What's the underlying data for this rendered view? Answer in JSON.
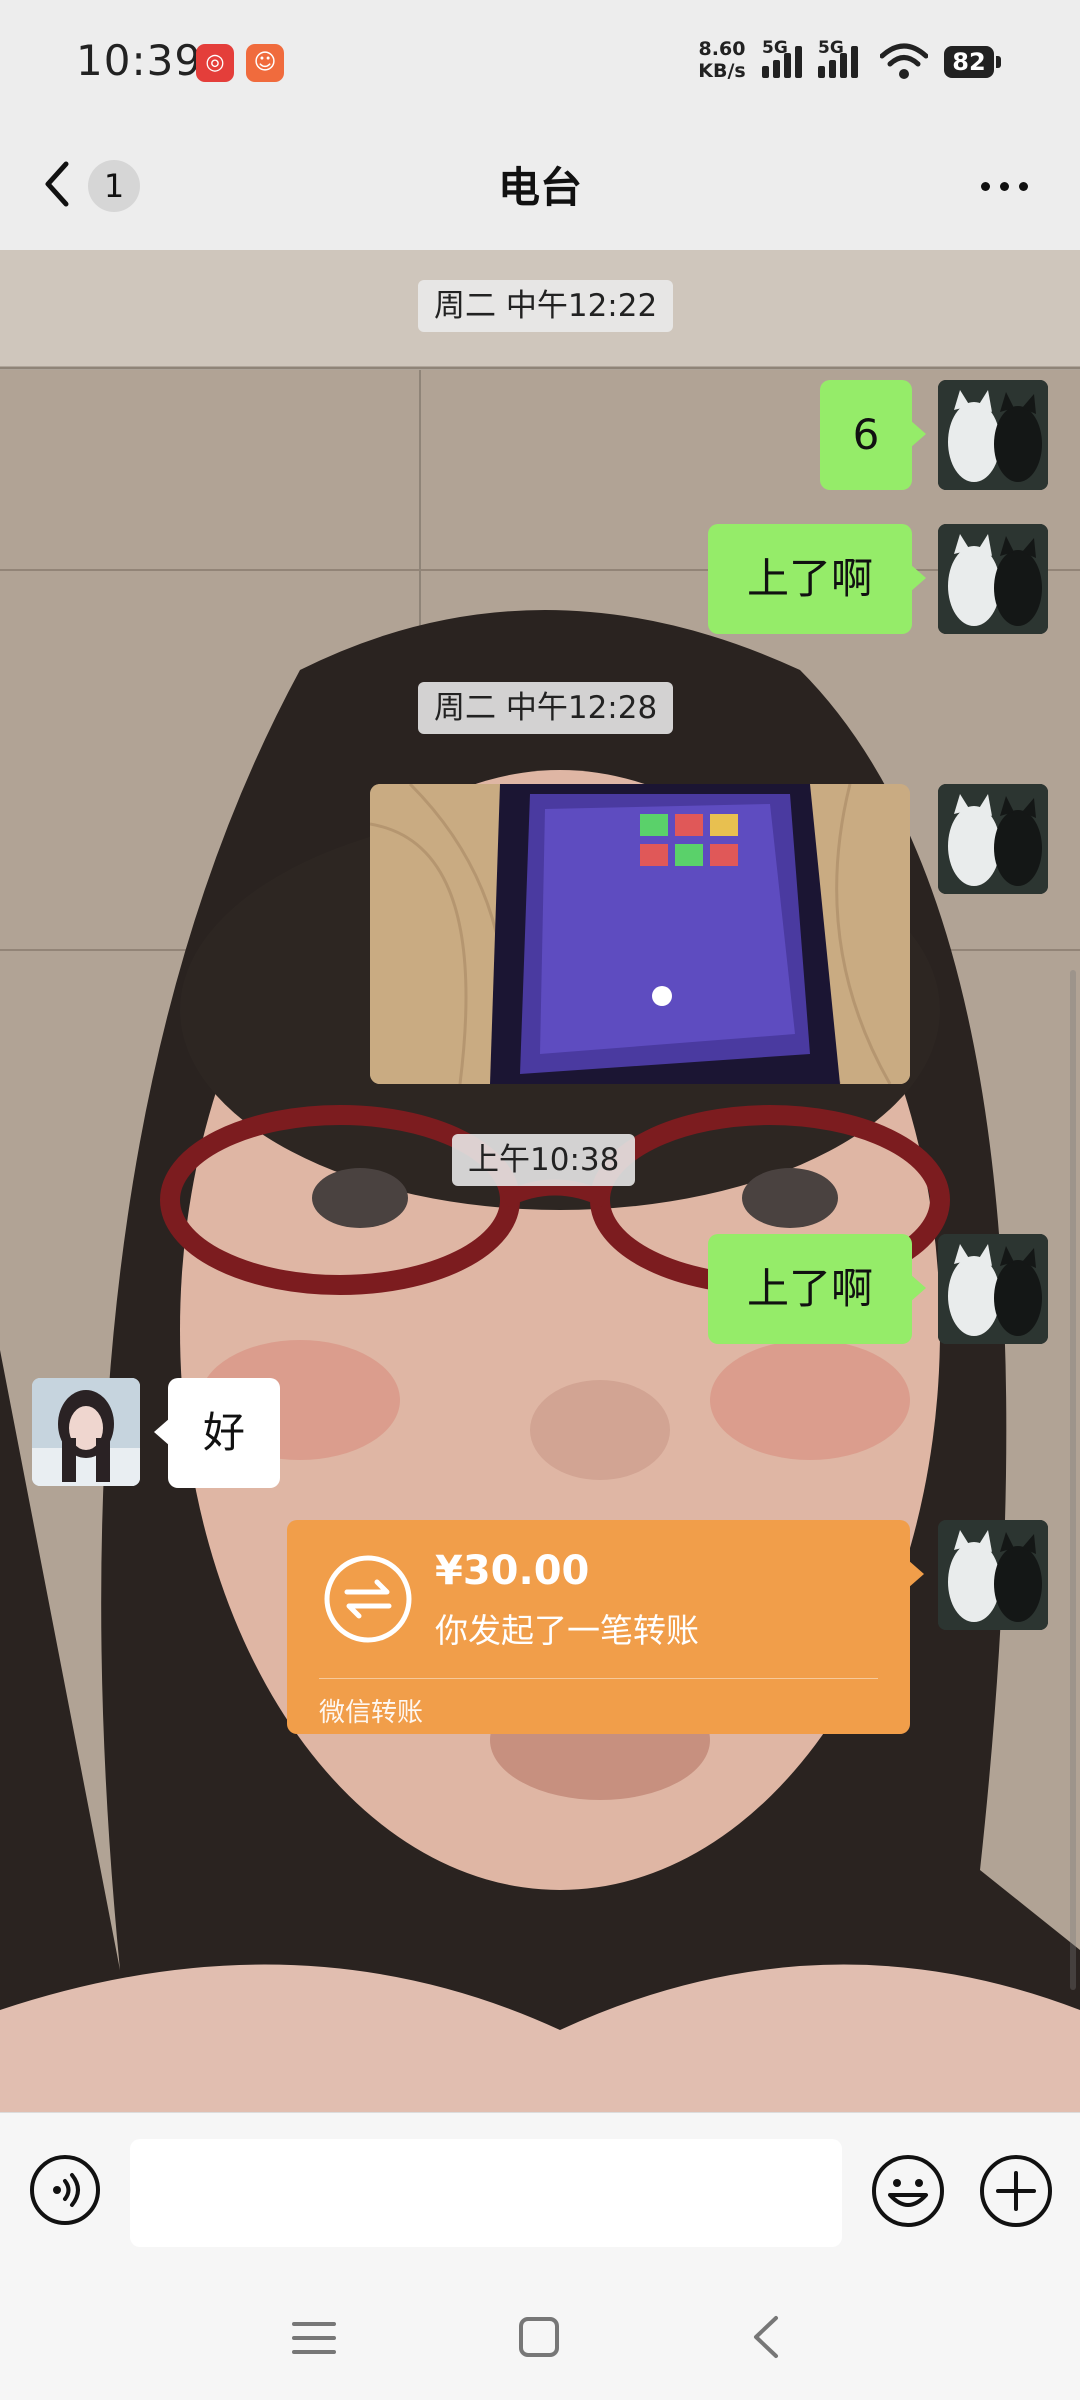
{
  "status_bar": {
    "time": "10:39",
    "app_icons": [
      "netease-music-icon",
      "clown-app-icon"
    ],
    "net_speed_value": "8.60",
    "net_speed_unit": "KB/s",
    "signal1_label": "5G",
    "signal2_label": "5G",
    "battery": "82"
  },
  "navbar": {
    "unread_badge": "1",
    "title": "电台"
  },
  "messages": {
    "ts1": "周二 中午12:22",
    "m1": "6",
    "m2": "上了啊",
    "ts2": "周二 中午12:28",
    "ts3": "上午10:38",
    "m4": "上了啊",
    "m5": "好",
    "transfer": {
      "amount": "¥30.00",
      "description": "你发起了一笔转账",
      "footer": "微信转账"
    }
  },
  "input_bar": {
    "placeholder": ""
  },
  "colors": {
    "self_bubble": "#95ec69",
    "other_bubble": "#ffffff",
    "transfer_card": "#f19e4a",
    "bar_background": "#ededed"
  }
}
